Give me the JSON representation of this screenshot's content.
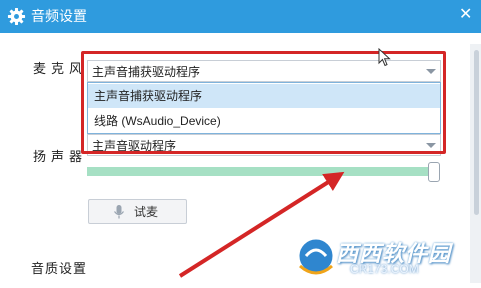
{
  "window": {
    "title": "音频设置"
  },
  "microphone": {
    "label": "麦克风",
    "selected": "主声音捕获驱动程序",
    "options": [
      "主声音捕获驱动程序",
      "线路 (WsAudio_Device)"
    ]
  },
  "speaker": {
    "label": "扬声器",
    "selected": "主声音驱动程序",
    "volume_fraction": 1.0
  },
  "test_button": {
    "label": "试麦"
  },
  "quality": {
    "label": "音质设置"
  },
  "watermark": {
    "brand": "西西软件园",
    "url": "CR173.COM"
  },
  "colors": {
    "titlebar": "#2f9bde",
    "highlight": "#d42626",
    "volume": "#a6e0c4"
  }
}
